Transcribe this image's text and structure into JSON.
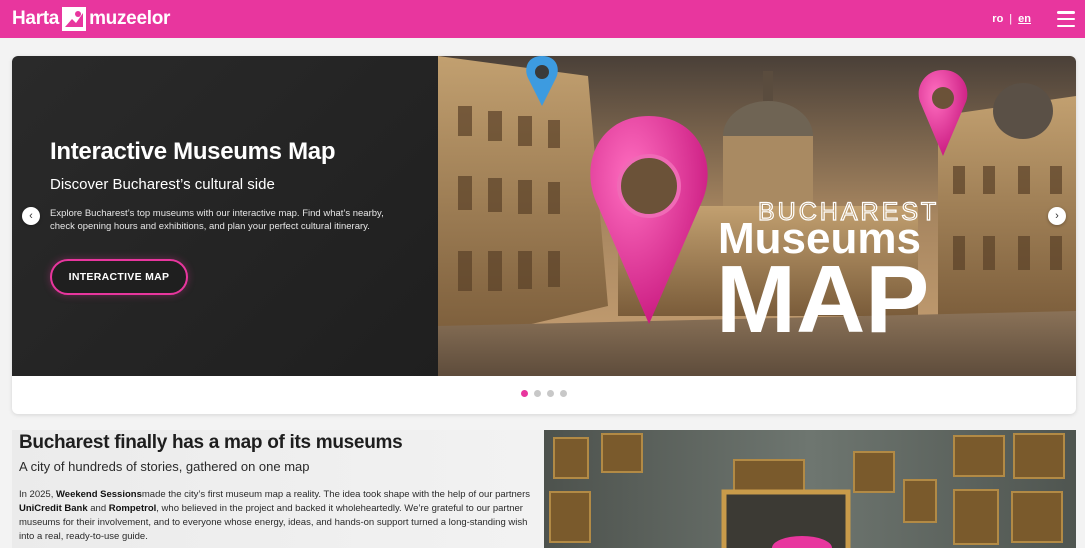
{
  "header": {
    "logo_left": "Harta",
    "logo_right": "muzeelor",
    "lang_ro": "ro",
    "lang_sep": "|",
    "lang_en": "en"
  },
  "hero": {
    "title": "Interactive Museums Map",
    "subtitle": "Discover Bucharest’s cultural side",
    "description": "Explore Bucharest’s top museums with our interactive map. Find what’s nearby, check opening hours and exhibitions, and plan your perfect cultural itinerary.",
    "button_label": "INTERACTIVE MAP",
    "image_text_line1": "BUCHAREST",
    "image_text_line2": "Museums",
    "image_text_line3": "MAP",
    "prev_arrow": "‹",
    "next_arrow": "›",
    "slide_count": 4,
    "active_slide": 1
  },
  "section": {
    "title": "Bucharest finally has a map of its museums",
    "subtitle": "A city of hundreds of stories, gathered on one map",
    "body_part1": "In 2025, ",
    "body_bold1": "Weekend Sessions",
    "body_part2": "made the city’s first museum map a reality. The idea took shape with the help of our partners ",
    "body_bold2": "UniCredit Bank",
    "body_part3": " and ",
    "body_bold3": "Rompetrol",
    "body_part4": ", who believed in the project and backed it wholeheartedly. We’re grateful to our partner museums for their involvement, and to everyone whose energy, ideas, and hands-on support turned a long-standing wish into a real, ready-to-use guide."
  },
  "colors": {
    "brand_pink": "#e8369e",
    "dark_panel": "#1f1f1f",
    "pin_blue": "#3d9be0"
  }
}
